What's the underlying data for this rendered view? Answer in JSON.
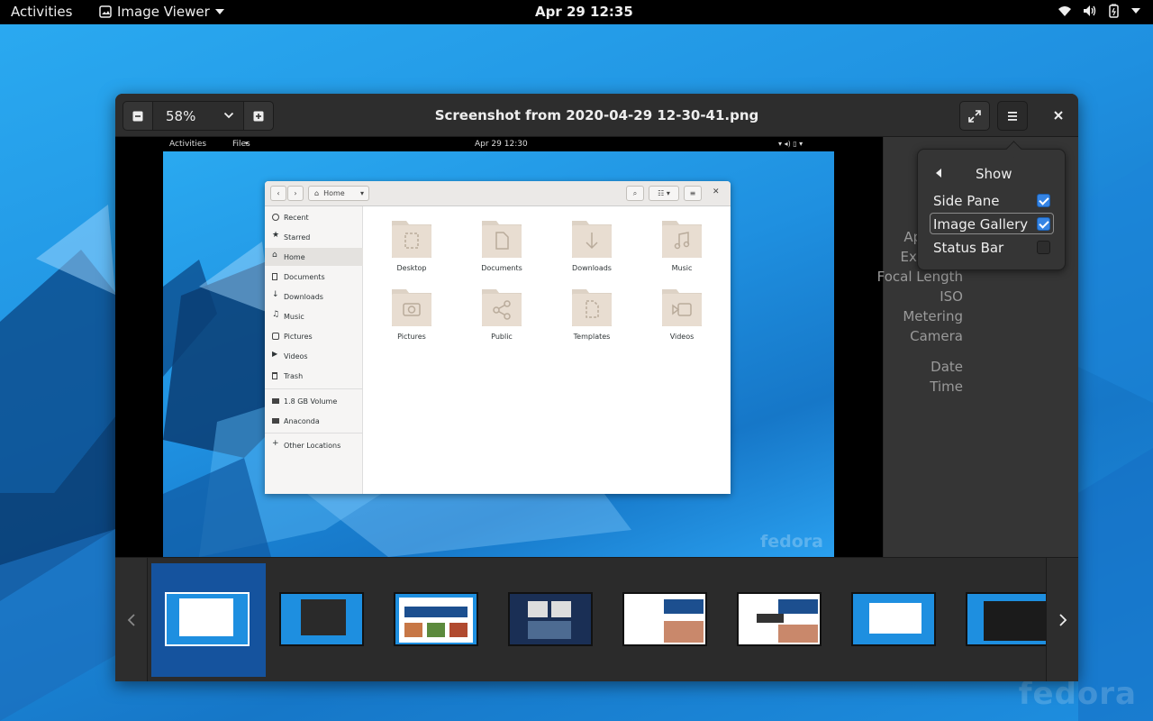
{
  "topbar": {
    "activities": "Activities",
    "app_menu": "Image Viewer",
    "clock": "Apr 29  12:35"
  },
  "window": {
    "title": "Screenshot from 2020-04-29 12-30-41.png",
    "zoom_value": "58%"
  },
  "menu_popover": {
    "title": "Show",
    "items": [
      {
        "label": "Side Pane",
        "checked": true
      },
      {
        "label": "Image Gallery",
        "checked": true
      },
      {
        "label": "Status Bar",
        "checked": false
      }
    ]
  },
  "side_pane": {
    "properties": [
      "Aperture",
      "Exposure",
      "Focal Length",
      "ISO",
      "Metering",
      "Camera"
    ],
    "datetime": [
      "Date",
      "Time"
    ]
  },
  "shown_image": {
    "topbar": {
      "activities": "Activities",
      "app": "Files",
      "clock": "Apr 29  12:30"
    },
    "files_window": {
      "location": "Home",
      "sidebar": [
        "Recent",
        "Starred",
        "Home",
        "Documents",
        "Downloads",
        "Music",
        "Pictures",
        "Videos",
        "Trash",
        "1.8 GB Volume",
        "Anaconda",
        "Other Locations"
      ],
      "folders": [
        "Desktop",
        "Documents",
        "Downloads",
        "Music",
        "Pictures",
        "Public",
        "Templates",
        "Videos"
      ]
    },
    "watermark": "fedora"
  },
  "gallery": {
    "thumbnails": [
      "Files window screenshot (selected)",
      "Terminal screenshot",
      "Browser screenshot",
      "Activities overview screenshot",
      "Files window screenshot",
      "Files window with overlay screenshot",
      "Files dialog screenshot",
      "Terminal system monitor screenshot"
    ],
    "selected_index": 0
  },
  "desktop": {
    "watermark": "fedora"
  },
  "colors": {
    "accent": "#3584e4",
    "selection": "#15539e",
    "header": "#2d2d2d",
    "pane": "#353535"
  }
}
